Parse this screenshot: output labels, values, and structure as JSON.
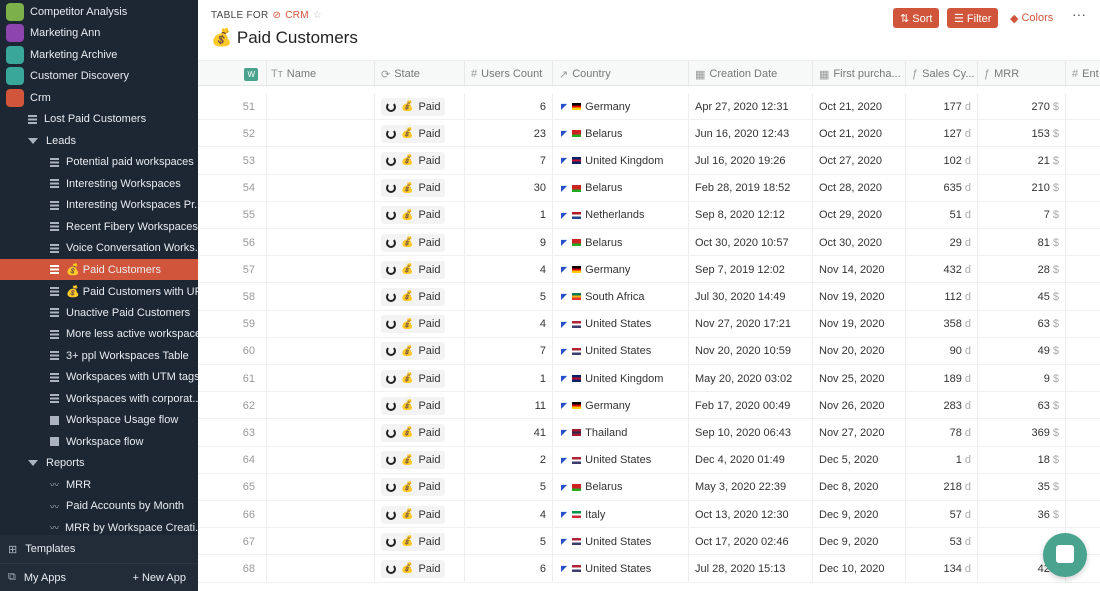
{
  "sidebar": {
    "apps": [
      {
        "label": "Competitor Analysis",
        "color": "#7bb04a",
        "icon": "accessibility-icon"
      },
      {
        "label": "Marketing Ann",
        "color": "#8e44ad",
        "icon": "lightning-icon"
      },
      {
        "label": "Marketing Archive",
        "color": "#3aa79b",
        "icon": "badge-icon"
      },
      {
        "label": "Customer Discovery",
        "color": "#3aa79b",
        "icon": "ear-icon"
      },
      {
        "label": "Crm",
        "color": "#d0553a",
        "icon": "crm-icon"
      }
    ],
    "items": [
      {
        "label": "Lost Paid Customers",
        "level": 1,
        "type": "table"
      },
      {
        "label": "Leads",
        "level": 1,
        "type": "folder"
      },
      {
        "label": "Potential paid workspaces",
        "level": 2,
        "type": "table"
      },
      {
        "label": "Interesting Workspaces",
        "level": 2,
        "type": "table"
      },
      {
        "label": "Interesting Workspaces Pr...",
        "level": 2,
        "type": "table"
      },
      {
        "label": "Recent Fibery Workspaces",
        "level": 2,
        "type": "table"
      },
      {
        "label": "Voice Conversation Works...",
        "level": 2,
        "type": "table"
      },
      {
        "label": "💰 Paid Customers",
        "level": 2,
        "type": "table",
        "active": true
      },
      {
        "label": "💰 Paid Customers with URL",
        "level": 2,
        "type": "table"
      },
      {
        "label": "Unactive Paid Customers",
        "level": 2,
        "type": "table"
      },
      {
        "label": "More less active workspaces",
        "level": 2,
        "type": "table"
      },
      {
        "label": "3+ ppl Workspaces Table",
        "level": 2,
        "type": "table"
      },
      {
        "label": "Workspaces with UTM tags",
        "level": 2,
        "type": "table"
      },
      {
        "label": "Workspaces with corporat...",
        "level": 2,
        "type": "table"
      },
      {
        "label": "Workspace Usage flow",
        "level": 2,
        "type": "doc"
      },
      {
        "label": "Workspace flow",
        "level": 2,
        "type": "doc"
      },
      {
        "label": "Reports",
        "level": 1,
        "type": "folder"
      },
      {
        "label": "MRR",
        "level": 2,
        "type": "chart"
      },
      {
        "label": "Paid Accounts by Month",
        "level": 2,
        "type": "chart"
      },
      {
        "label": "MRR by Workspace Creati...",
        "level": 2,
        "type": "chart"
      }
    ],
    "templates": "Templates",
    "my_apps": "My Apps",
    "new_app": "+ New App"
  },
  "header": {
    "crumb_prefix": "TABLE FOR",
    "crumb_app": "CRM",
    "title": "💰 Paid Customers",
    "sort": "⇅ Sort",
    "filter": "☰ Filter",
    "colors": "Colors",
    "more": "···"
  },
  "columns": [
    {
      "label": "W",
      "icon": ""
    },
    {
      "label": "Name",
      "icon": "Tт"
    },
    {
      "label": "State",
      "icon": "⟳"
    },
    {
      "label": "Users Count",
      "icon": "#"
    },
    {
      "label": "Country",
      "icon": "↗"
    },
    {
      "label": "Creation Date",
      "icon": "▦"
    },
    {
      "label": "First purcha...",
      "icon": "▦"
    },
    {
      "label": "Sales Cy...",
      "icon": "ƒ"
    },
    {
      "label": "MRR",
      "icon": "ƒ"
    },
    {
      "label": "Ent",
      "icon": "#"
    }
  ],
  "units": {
    "days": "d",
    "currency": "$"
  },
  "state_label": "Paid",
  "flags": {
    "Germany": "#000,#d00,#fc0",
    "Belarus": "#c22,#c22,#2a2",
    "United Kingdom": "#012169,#c8102e,#012169",
    "Netherlands": "#ae1c28,#fff,#21468b",
    "South Africa": "#007a4d,#ffb612,#de3831",
    "United States": "#b22234,#fff,#3c3b6e",
    "Thailand": "#a51931,#2d2a4a,#a51931",
    "Italy": "#009246,#fff,#ce2b37"
  },
  "rows": [
    [
      "51",
      "6",
      "Germany",
      "Apr 27, 2020 12:31",
      "Oct 21, 2020",
      "177",
      "270"
    ],
    [
      "52",
      "23",
      "Belarus",
      "Jun 16, 2020 12:43",
      "Oct 21, 2020",
      "127",
      "153"
    ],
    [
      "53",
      "7",
      "United Kingdom",
      "Jul 16, 2020 19:26",
      "Oct 27, 2020",
      "102",
      "21"
    ],
    [
      "54",
      "30",
      "Belarus",
      "Feb 28, 2019 18:52",
      "Oct 28, 2020",
      "635",
      "210"
    ],
    [
      "55",
      "1",
      "Netherlands",
      "Sep 8, 2020 12:12",
      "Oct 29, 2020",
      "51",
      "7"
    ],
    [
      "56",
      "9",
      "Belarus",
      "Oct 30, 2020 10:57",
      "Oct 30, 2020",
      "29",
      "81"
    ],
    [
      "57",
      "4",
      "Germany",
      "Sep 7, 2019 12:02",
      "Nov 14, 2020",
      "432",
      "28"
    ],
    [
      "58",
      "5",
      "South Africa",
      "Jul 30, 2020 14:49",
      "Nov 19, 2020",
      "112",
      "45"
    ],
    [
      "59",
      "4",
      "United States",
      "Nov 27, 2020 17:21",
      "Nov 19, 2020",
      "358",
      "63"
    ],
    [
      "60",
      "7",
      "United States",
      "Nov 20, 2020 10:59",
      "Nov 20, 2020",
      "90",
      "49"
    ],
    [
      "61",
      "1",
      "United Kingdom",
      "May 20, 2020 03:02",
      "Nov 25, 2020",
      "189",
      "9"
    ],
    [
      "62",
      "11",
      "Germany",
      "Feb 17, 2020 00:49",
      "Nov 26, 2020",
      "283",
      "63"
    ],
    [
      "63",
      "41",
      "Thailand",
      "Sep 10, 2020 06:43",
      "Nov 27, 2020",
      "78",
      "369"
    ],
    [
      "64",
      "2",
      "United States",
      "Dec 4, 2020 01:49",
      "Dec 5, 2020",
      "1",
      "18"
    ],
    [
      "65",
      "5",
      "Belarus",
      "May 3, 2020 22:39",
      "Dec 8, 2020",
      "218",
      "35"
    ],
    [
      "66",
      "4",
      "Italy",
      "Oct 13, 2020 12:30",
      "Dec 9, 2020",
      "57",
      "36"
    ],
    [
      "67",
      "5",
      "United States",
      "Oct 17, 2020 02:46",
      "Dec 9, 2020",
      "53",
      ""
    ],
    [
      "68",
      "6",
      "United States",
      "Jul 28, 2020 15:13",
      "Dec 10, 2020",
      "134",
      "42"
    ]
  ]
}
